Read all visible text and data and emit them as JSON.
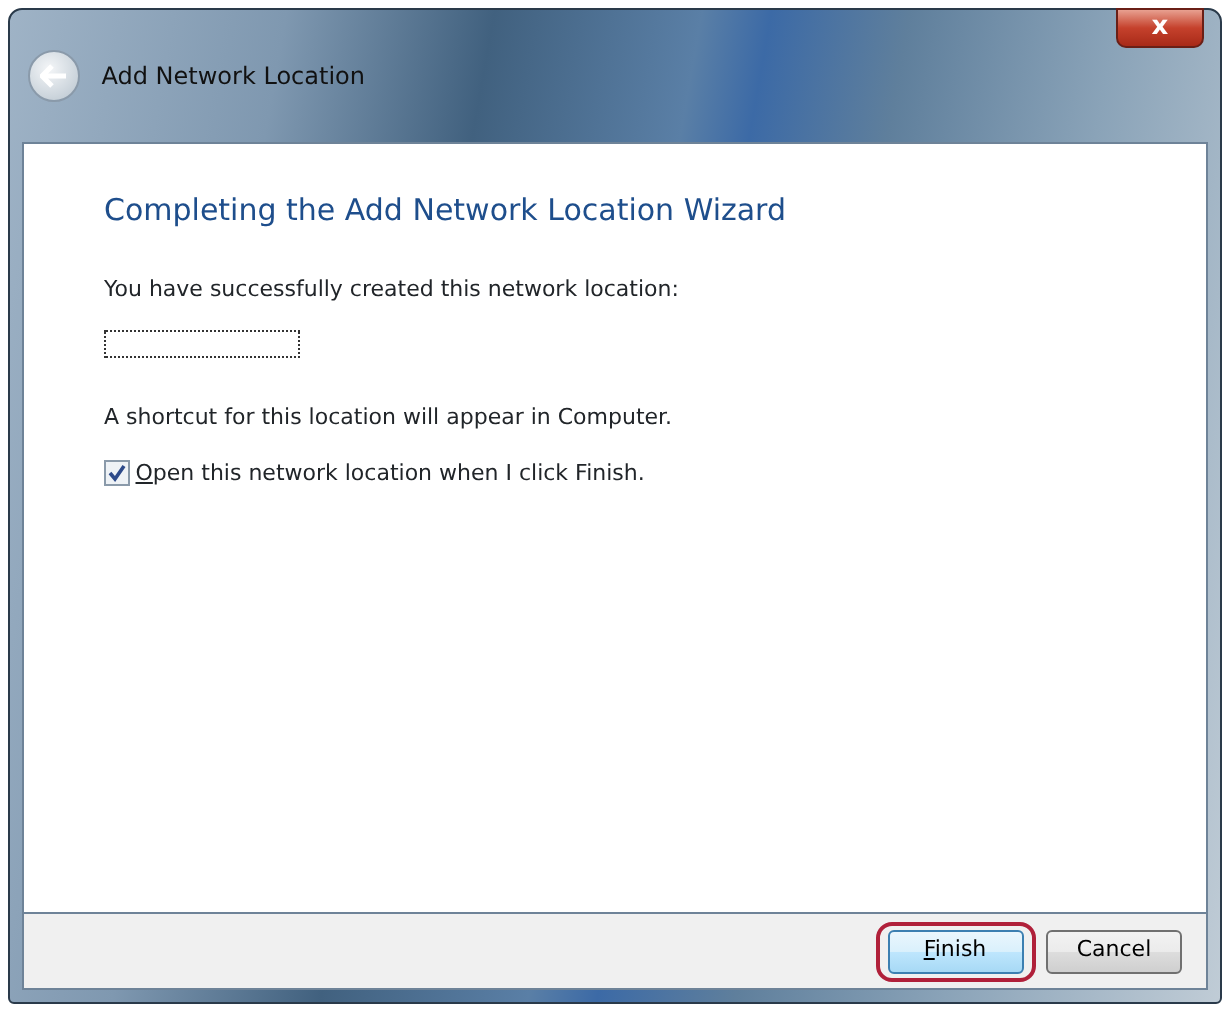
{
  "window": {
    "title": "Add Network Location",
    "close_label": "x"
  },
  "heading": "Completing the Add Network Location Wizard",
  "message": "You have successfully created this network location:",
  "location_field": {
    "focused": true
  },
  "note": "A shortcut for this location will appear in Computer.",
  "option": {
    "label": "Open this network location when I click Finish.",
    "checked": true,
    "underline_first": true
  },
  "buttons": [
    {
      "label": "Finish",
      "underline_first": true,
      "highlighted": true
    },
    {
      "label": "Cancel",
      "underline_first": false,
      "highlighted": false
    }
  ]
}
